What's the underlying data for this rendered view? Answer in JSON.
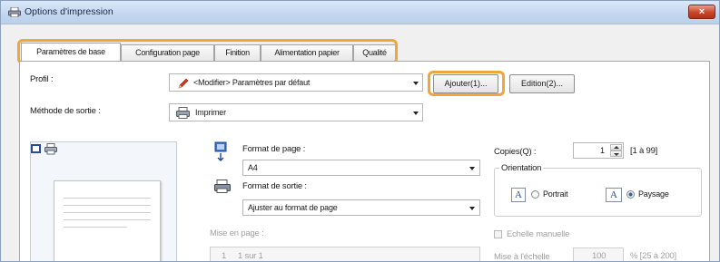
{
  "window": {
    "title": "Options d'impression",
    "close_glyph": "×",
    "icon": "printer-icon"
  },
  "tabs": [
    {
      "label": "Paramètres de base",
      "active": true
    },
    {
      "label": "Configuration page",
      "active": false
    },
    {
      "label": "Finition",
      "active": false
    },
    {
      "label": "Alimentation papier",
      "active": false
    },
    {
      "label": "Qualité",
      "active": false
    }
  ],
  "profile": {
    "label": "Profil :",
    "value": "<Modifier> Paramètres par défaut",
    "icon": "pencil-icon",
    "add_button": "Ajouter(1)...",
    "edit_button": "Edition(2)..."
  },
  "output_method": {
    "label": "Méthode de sortie :",
    "value": "Imprimer",
    "icon": "printer-icon"
  },
  "page_format": {
    "label": "Format de page :",
    "value": "A4",
    "icon": "page-size-icon"
  },
  "output_format": {
    "label": "Format de sortie :",
    "value": "Ajuster au format de page",
    "icon": "output-size-icon"
  },
  "layout": {
    "label": "Mise en page :",
    "value": "1 sur 1",
    "number": "1"
  },
  "copies": {
    "label": "Copies(Q) :",
    "value": "1",
    "range": "[1 à 99]"
  },
  "orientation": {
    "label": "Orientation",
    "options": [
      {
        "label": "Portrait",
        "glyph": "A",
        "selected": false
      },
      {
        "label": "Paysage",
        "glyph": "A",
        "selected": true
      }
    ]
  },
  "manual_scale": {
    "label": "Echelle manuelle",
    "value": "100",
    "range": "% [25 à 200]",
    "field_label": "Mise à l'échelle"
  },
  "colors": {
    "highlight": "#f2a53a",
    "close": "#c8452a"
  }
}
